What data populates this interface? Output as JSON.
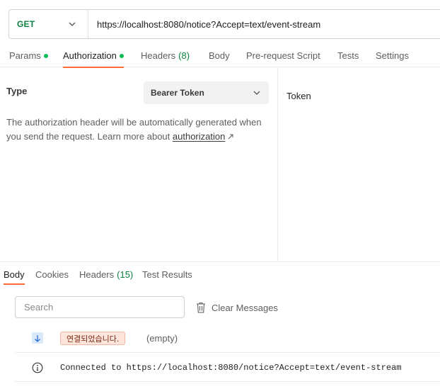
{
  "request": {
    "method": "GET",
    "url": "https://localhost:8080/notice?Accept=text/event-stream"
  },
  "request_tabs": [
    {
      "label": "Params",
      "dot": true
    },
    {
      "label": "Authorization",
      "dot": true,
      "active": true
    },
    {
      "label": "Headers",
      "count": "(8)"
    },
    {
      "label": "Body"
    },
    {
      "label": "Pre-request Script"
    },
    {
      "label": "Tests"
    },
    {
      "label": "Settings"
    }
  ],
  "auth": {
    "type_label": "Type",
    "type_value": "Bearer Token",
    "help_text": "The authorization header will be automatically generated when you send the request. Learn more about ",
    "help_link": "authorization",
    "token_label": "Token"
  },
  "response_tabs": [
    {
      "label": "Body",
      "active": true
    },
    {
      "label": "Cookies"
    },
    {
      "label": "Headers",
      "count": "(15)"
    },
    {
      "label": "Test Results"
    }
  ],
  "response": {
    "search_placeholder": "Search",
    "clear_label": "Clear Messages",
    "messages": [
      {
        "icon": "arrow-down-icon",
        "badge": "연결되었습니다.",
        "extra": "(empty)"
      },
      {
        "icon": "info-icon",
        "text": "Connected to https://localhost:8080/notice?Accept=text/event-stream"
      }
    ]
  },
  "colors": {
    "accent": "#ff6c37",
    "method_green": "#0a7f3f",
    "dot_green": "#0cbb52",
    "badge_bg": "#fde5dc"
  }
}
